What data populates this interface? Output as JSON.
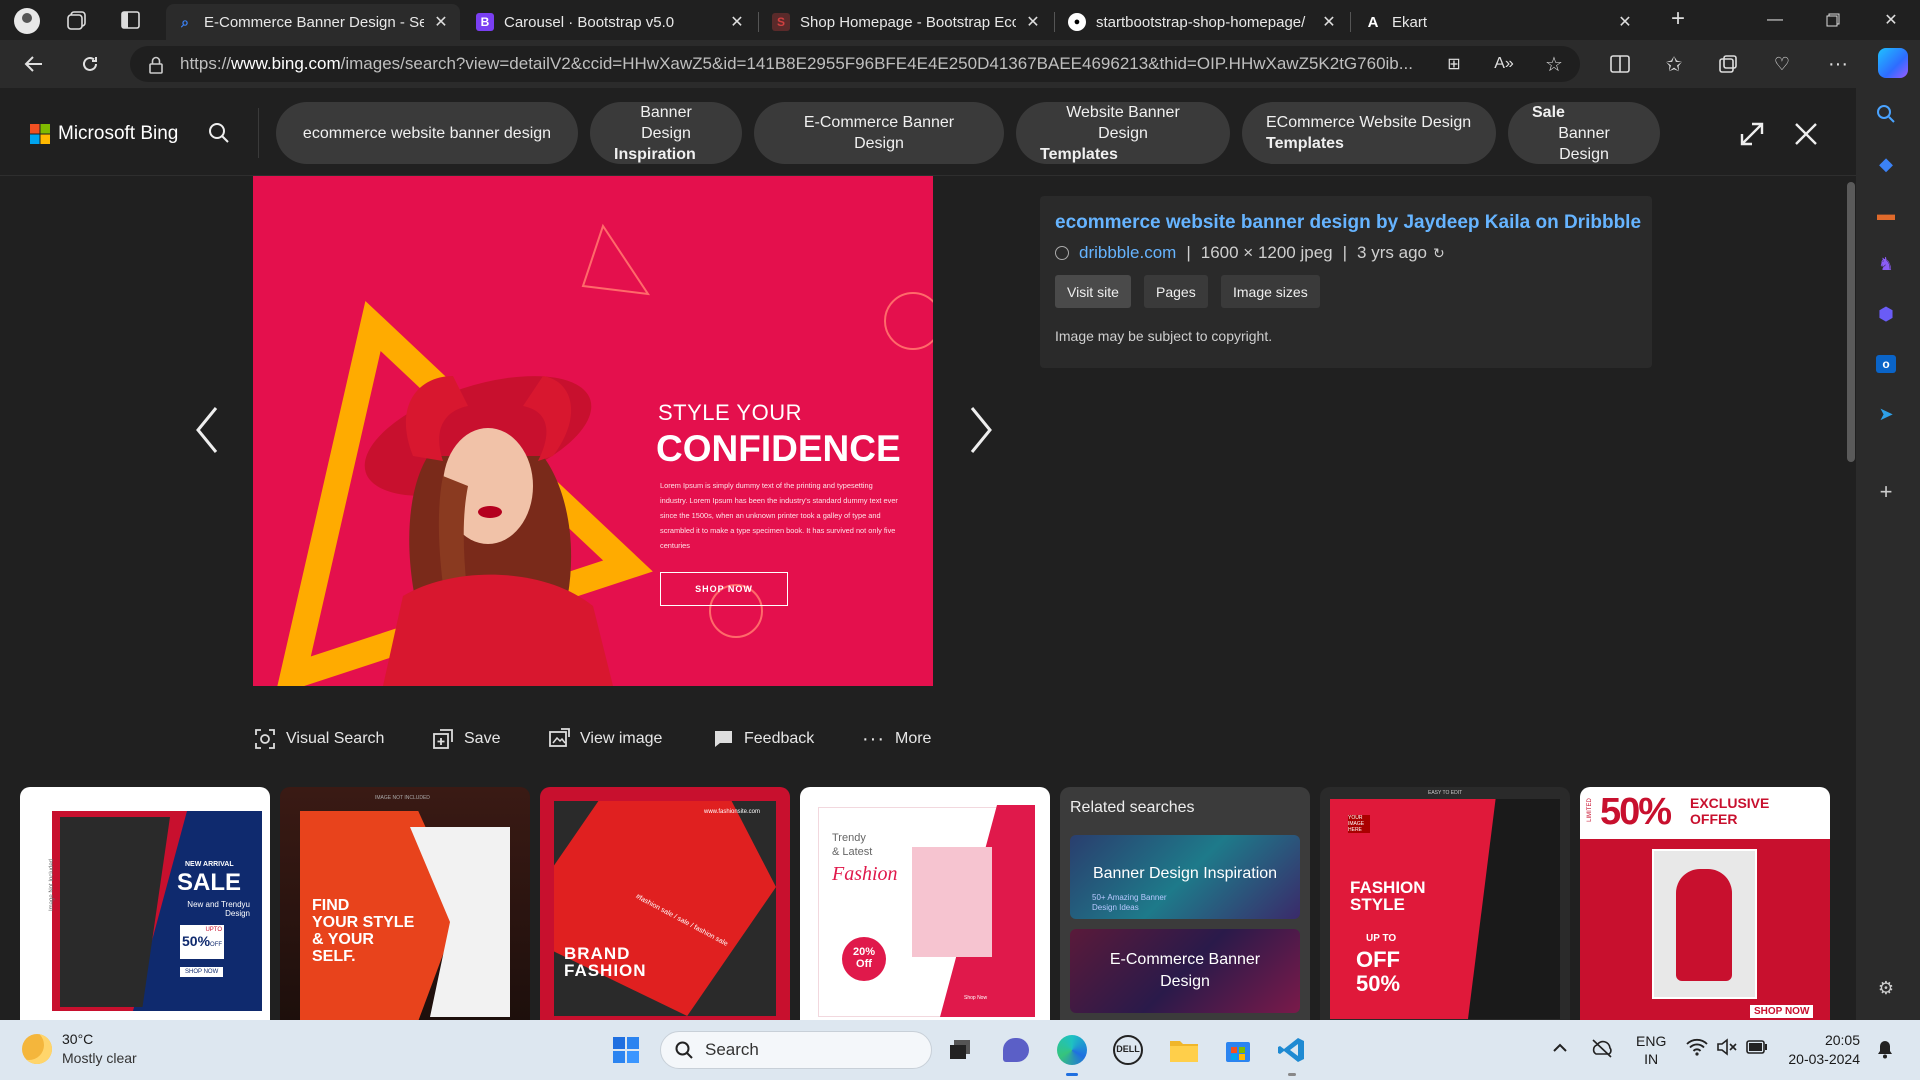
{
  "browser": {
    "tabs": [
      {
        "title": "E-Commerce Banner Design - Se",
        "icon": "bing-search-icon",
        "active": true
      },
      {
        "title": "Carousel · Bootstrap v5.0",
        "icon": "bootstrap-icon",
        "active": false
      },
      {
        "title": "Shop Homepage - Bootstrap Ecc",
        "icon": "startbootstrap-icon",
        "active": false
      },
      {
        "title": "startbootstrap-shop-homepage/",
        "icon": "github-icon",
        "active": false
      },
      {
        "title": "Ekart",
        "icon": "ekart-icon",
        "active": false
      }
    ],
    "url_prefix": "https://",
    "url_host": "www.bing.com",
    "url_rest": "/images/search?view=detailV2&ccid=HHwXawZ5&id=141B8E2955F96BFE4E4E250D41367BAEE4696213&thid=OIP.HHwXawZ5K2tG760ib..."
  },
  "bing": {
    "logo_text": "Microsoft Bing",
    "chips": [
      {
        "line1": "ecommerce website banner design",
        "line2": ""
      },
      {
        "line1": "Banner Design",
        "line2": "Inspiration"
      },
      {
        "line1": "E-Commerce Banner Design",
        "line2": ""
      },
      {
        "line1": "Website Banner Design",
        "line2": "Templates"
      },
      {
        "line1": "ECommerce Website Design",
        "line2": "Templates"
      },
      {
        "line1": "Sale",
        "line2": "Banner Design"
      }
    ]
  },
  "banner": {
    "small_title": "STYLE YOUR",
    "big_title": "CONFIDENCE",
    "body": "Lorem Ipsum is simply dummy text of the printing and typesetting industry. Lorem Ipsum has been the industry's standard dummy text ever since the 1500s, when an unknown printer took a galley of type and scrambled it to make a type specimen book. It has survived not only five centuries",
    "cta": "SHOP NOW"
  },
  "info": {
    "title": "ecommerce website banner design by Jaydeep Kaila on Dribbble",
    "source": "dribbble.com",
    "meta_size": "1600 × 1200 jpeg",
    "meta_age": "3 yrs ago",
    "buttons": [
      "Visit site",
      "Pages",
      "Image sizes"
    ],
    "copyright": "Image may be subject to copyright."
  },
  "actions": [
    "Visual Search",
    "Save",
    "View image",
    "Feedback",
    "More"
  ],
  "thumbs": {
    "t1": {
      "badge": "NEW ARRIVAL",
      "title": "SALE",
      "sub": "New and Trendyu Design",
      "offer": "50%",
      "offer_small": "UPTO",
      "offer_off": "OFF",
      "btn": "SHOP NOW",
      "side": "Image Not Included"
    },
    "t2": {
      "line1": "FIND",
      "line2": "YOUR STYLE",
      "line3": "& YOUR",
      "line4": "SELF.",
      "top": "IMAGE NOT INCLUDED"
    },
    "t3": {
      "line1": "BRAND",
      "line2": "FASHION",
      "url": "www.fashionsite.com",
      "diag": "#fashion sale / sale / fashion sale"
    },
    "t4": {
      "line1": "Trendy",
      "line2": "& Latest",
      "script": "Fashion",
      "pct": "20%",
      "off": "Off",
      "shop": "Shop Now"
    },
    "related": {
      "header": "Related searches",
      "r1": "Banner Design Inspiration",
      "r1_sub": "50+ Amazing Banner Design Ideas",
      "r2": "E-Commerce Banner Design"
    },
    "t6": {
      "top": "EASY TO EDIT",
      "tag": "YOUR IMAGE HERE",
      "line1": "FASHION",
      "line2": "STYLE",
      "upto": "UP TO",
      "off": "OFF",
      "pct": "50%"
    },
    "t7": {
      "big": "50%",
      "ex1": "EXCLUSIVE",
      "ex2": "OFFER",
      "limited": "LIMITED",
      "shop": "SHOP NOW"
    }
  },
  "taskbar": {
    "weather_temp": "30°C",
    "weather_desc": "Mostly clear",
    "search": "Search",
    "lang1": "ENG",
    "lang2": "IN",
    "time": "20:05",
    "date": "20-03-2024"
  }
}
